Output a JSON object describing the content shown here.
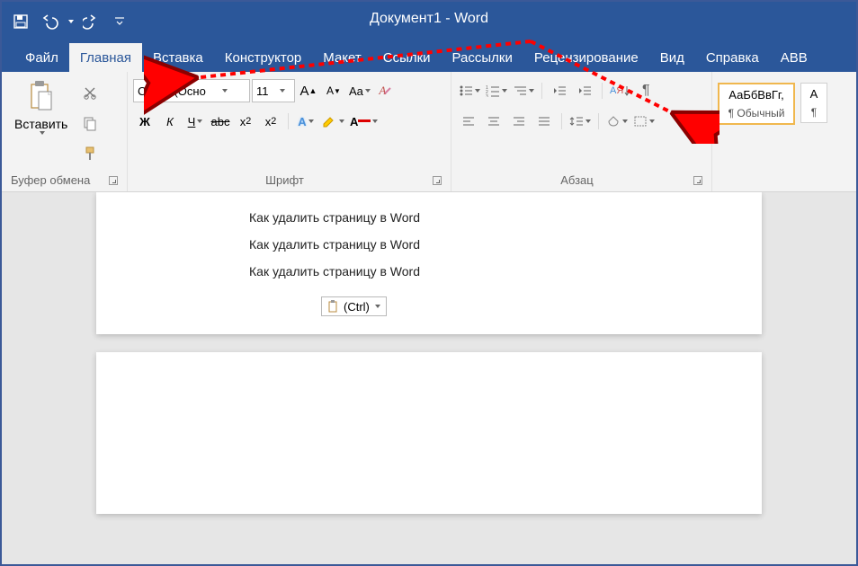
{
  "title": "Документ1  -  Word",
  "tabs": [
    "Файл",
    "Главная",
    "Вставка",
    "Конструктор",
    "Макет",
    "Ссылки",
    "Рассылки",
    "Рецензирование",
    "Вид",
    "Справка",
    "ABB"
  ],
  "active_tab_index": 1,
  "clipboard": {
    "paste": "Вставить",
    "group_label": "Буфер обмена"
  },
  "font": {
    "name": "Calibri (Осно",
    "size": "11",
    "group_label": "Шрифт",
    "bold": "Ж",
    "italic": "К",
    "underline": "Ч",
    "strike": "abc",
    "sub": "x",
    "sup": "x",
    "aa": "Aa",
    "clear": "A"
  },
  "paragraph": {
    "group_label": "Абзац"
  },
  "styles": {
    "sample1": "АаБбВвГг,",
    "normal": "¶ Обычный",
    "sample2": "А",
    "normal2": "¶"
  },
  "doc": {
    "lines": [
      "Как удалить страницу в Word",
      "Как удалить страницу в Word",
      "Как удалить страницу в Word"
    ],
    "paste_opts": "(Ctrl)"
  }
}
